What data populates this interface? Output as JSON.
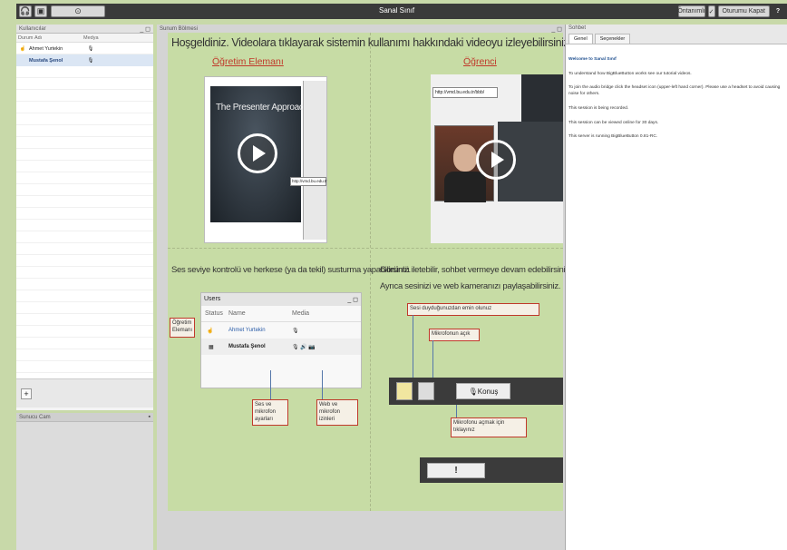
{
  "topbar": {
    "title": "Sanal Sınıf",
    "layout_select": "Öntanımlı",
    "logout": "Oturumu Kapat",
    "help": "?"
  },
  "users": {
    "title": "Kullanıcılar",
    "columns": [
      "Durum",
      "Adı",
      "Medya"
    ],
    "rows": [
      {
        "icon": "☝",
        "name": "Ahmet Yurtekin",
        "media": "🎙"
      },
      {
        "icon": "",
        "name": "Mustafa Şenol",
        "media": "🎙"
      }
    ]
  },
  "chat": {
    "title": "Sunucu Cam"
  },
  "presentation": {
    "title": "Sunum Bölmesi"
  },
  "slide": {
    "welcome": "Hoşgeldiniz. Videolara tıklayarak sistemin kullanımı hakkındaki videoyu izleyebilirsiniz.",
    "teacher_label": "Öğretim Elemanı",
    "student_label": "Öğrenci",
    "video1_caption": "The Presenter Approach",
    "video1_url": "http://vmd.bu.edu.tr",
    "video2_url": "http://vmd.bu.edu.tr/bbb/",
    "left_section": "Ses seviye kontrolü ve herkese (ya da tekil) susturma yapabilirsiniz.",
    "right_section_1": "Görüntü iletebilir, sohbet vermeye devam edebilirsiniz.",
    "right_section_2": "Ayrıca sesinizi ve web kameranızı paylaşabilirsiniz.",
    "mini_panel": {
      "title": "Users",
      "columns": [
        "Status",
        "Name",
        "Media"
      ],
      "rows": [
        {
          "name": "Ahmet Yurtekin",
          "media": "🎙"
        },
        {
          "name": "Mustafa Şenol",
          "media": "🎙 🔊 📷"
        }
      ]
    },
    "callout_teacher": "Öğretim Elemanı",
    "callout_mute": "Ses ve mikrofon ayarları",
    "callout_sharing": "Web ve mikrofon izinleri",
    "callout_share_webcam": "Sesi duyduğunuzdan emin olunuz",
    "callout_camera": "Mikrofonun açık",
    "callout_talk": "Mikrofonu açmak için tıklayınız",
    "talk_label": "Konuş",
    "talk2_label": "!"
  },
  "chatpanel": {
    "tabs": [
      "Genel",
      "Seçenekler"
    ],
    "messages": [
      {
        "text": "Welcome to Sanal Sınıf",
        "bold": true
      },
      {
        "text": "To understand how BigBlueButton works see our tutorial videos.",
        "bold": false
      },
      {
        "text": "To join the audio bridge click the headset icon (upper-left hand corner). Please use a headset to avoid causing noise for others.",
        "bold": false
      },
      {
        "text": "This session is being recorded.",
        "bold": false
      },
      {
        "text": "This session can be viewed online for 30 days.",
        "bold": false
      },
      {
        "text": "This server is running BigBlueButton 0.81-RC.",
        "bold": false
      }
    ]
  }
}
